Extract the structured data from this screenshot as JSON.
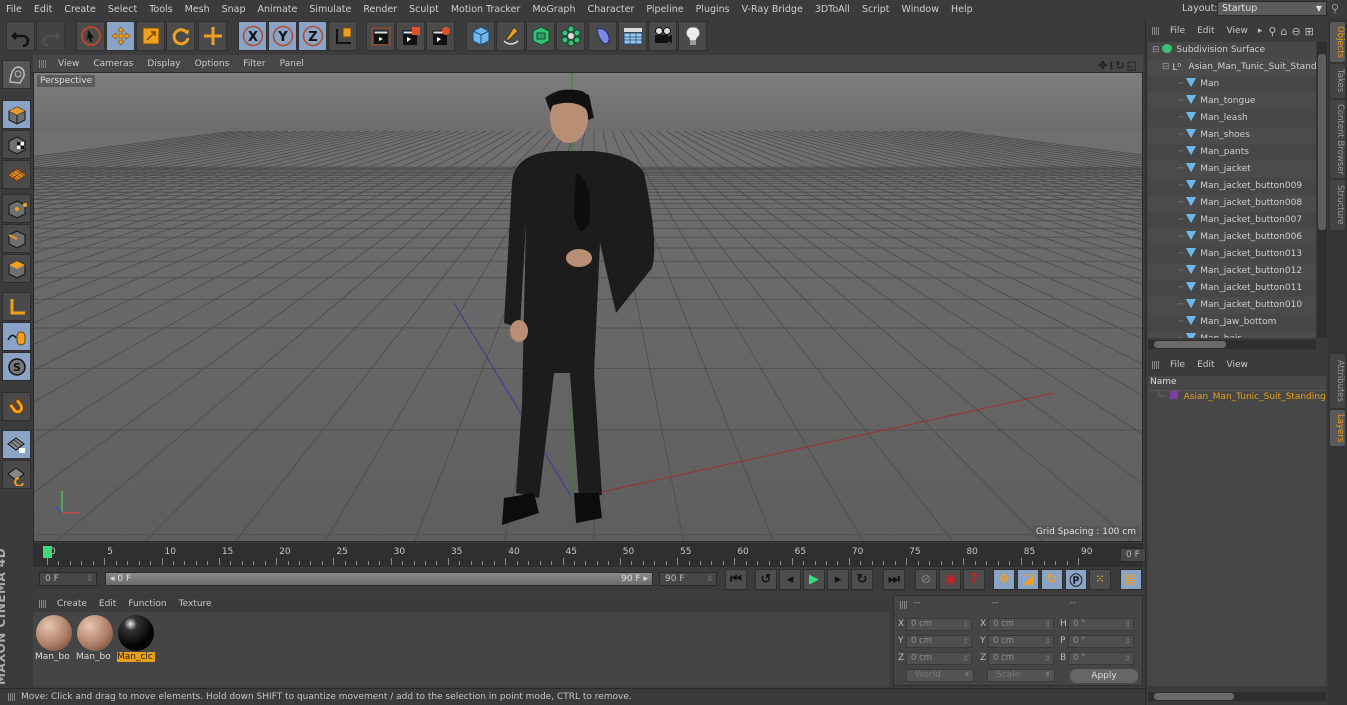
{
  "app": {
    "name": "Cinema 4D"
  },
  "menubar": {
    "items": [
      "File",
      "Edit",
      "Create",
      "Select",
      "Tools",
      "Mesh",
      "Snap",
      "Animate",
      "Simulate",
      "Render",
      "Sculpt",
      "Motion Tracker",
      "MoGraph",
      "Character",
      "Pipeline",
      "Plugins",
      "V-Ray Bridge",
      "3DToAll",
      "Script",
      "Window",
      "Help"
    ],
    "layout_label": "Layout:",
    "layout_value": "Startup"
  },
  "toolbar": {
    "tools": [
      "undo-icon",
      "redo-icon",
      "live-selection-icon",
      "move-icon",
      "scale-icon",
      "rotate-icon",
      "recent-tool-icon",
      "x-axis-lock-icon",
      "y-axis-lock-icon",
      "z-axis-lock-icon",
      "coordinate-system-icon",
      "render-view-icon",
      "render-picture-viewer-icon",
      "render-settings-icon",
      "cube-primitive-icon",
      "pen-spline-icon",
      "subdivision-surface-icon",
      "cloner-icon",
      "deformer-icon",
      "floor-icon",
      "camera-icon",
      "light-icon"
    ]
  },
  "viewport": {
    "menu": [
      "View",
      "Cameras",
      "Display",
      "Options",
      "Filter",
      "Panel"
    ],
    "label": "Perspective",
    "grid_spacing": "Grid Spacing : 100 cm",
    "nav_icons": [
      "move-view-icon",
      "dolly-view-icon",
      "rotate-view-icon",
      "maximize-view-icon"
    ]
  },
  "left_tools": [
    "make-editable-icon",
    "model-mode-icon",
    "texture-mode-icon",
    "workplane-mode-icon",
    "points-mode-icon",
    "edges-mode-icon",
    "polygons-mode-icon",
    "axis-mode-icon",
    "tweak-mode-icon",
    "solo-icon",
    "snap-icon",
    "workplane-lock-icon",
    "workplane-align-icon"
  ],
  "timeline": {
    "ticks": [
      "0",
      "5",
      "10",
      "15",
      "20",
      "25",
      "30",
      "35",
      "40",
      "45",
      "50",
      "55",
      "60",
      "65",
      "70",
      "75",
      "80",
      "85",
      "90"
    ],
    "current_frame": "0 F",
    "start_field": "0 F",
    "range_start": "0 F",
    "range_end": "90 F",
    "end_field": "90 F",
    "min_frame": 0,
    "max_frame": 90,
    "playhead_frame": 0
  },
  "transport": {
    "buttons": [
      "go-to-start-icon",
      "previous-key-icon",
      "previous-frame-icon",
      "play-icon",
      "next-frame-icon",
      "next-key-icon",
      "go-to-end-icon",
      "record-off-icon",
      "autokey-icon",
      "keyframe-selection-icon",
      "key-position-icon",
      "key-scale-icon",
      "key-rotation-icon",
      "key-parameter-icon",
      "key-pla-icon",
      "timeline-icon"
    ]
  },
  "materials": {
    "menu": [
      "Create",
      "Edit",
      "Function",
      "Texture"
    ],
    "items": [
      {
        "name": "Man_bo",
        "selected": false,
        "type": "skin"
      },
      {
        "name": "Man_bo",
        "selected": false,
        "type": "skin"
      },
      {
        "name": "Man_clc",
        "selected": true,
        "type": "black"
      }
    ]
  },
  "brand": {
    "logo": "MAXON CINEMA 4D"
  },
  "coordinates": {
    "headers": [
      "--",
      "--",
      "--"
    ],
    "rows": [
      {
        "l1": "X",
        "v1": "0 cm",
        "l2": "X",
        "v2": "0 cm",
        "l3": "H",
        "v3": "0 °"
      },
      {
        "l1": "Y",
        "v1": "0 cm",
        "l2": "Y",
        "v2": "0 cm",
        "l3": "P",
        "v3": "0 °"
      },
      {
        "l1": "Z",
        "v1": "0 cm",
        "l2": "Z",
        "v2": "0 cm",
        "l3": "B",
        "v3": "0 °"
      }
    ],
    "space_select": "World",
    "mode_select": "Scale",
    "apply_label": "Apply"
  },
  "status": {
    "text": "Move: Click and drag to move elements. Hold down SHIFT to quantize movement / add to the selection in point mode, CTRL to remove."
  },
  "objects_panel": {
    "menu": [
      "File",
      "Edit",
      "View"
    ],
    "tree": [
      {
        "name": "Subdivision Surface",
        "level": 0,
        "icon": "subdivision"
      },
      {
        "name": "Asian_Man_Tunic_Suit_Standi",
        "level": 1,
        "icon": "null"
      },
      {
        "name": "Man",
        "level": 2,
        "icon": "polygon"
      },
      {
        "name": "Man_tongue",
        "level": 2,
        "icon": "polygon"
      },
      {
        "name": "Man_leash",
        "level": 2,
        "icon": "polygon"
      },
      {
        "name": "Man_shoes",
        "level": 2,
        "icon": "polygon"
      },
      {
        "name": "Man_pants",
        "level": 2,
        "icon": "polygon"
      },
      {
        "name": "Man_jacket",
        "level": 2,
        "icon": "polygon"
      },
      {
        "name": "Man_jacket_button009",
        "level": 2,
        "icon": "polygon"
      },
      {
        "name": "Man_jacket_button008",
        "level": 2,
        "icon": "polygon"
      },
      {
        "name": "Man_jacket_button007",
        "level": 2,
        "icon": "polygon"
      },
      {
        "name": "Man_jacket_button006",
        "level": 2,
        "icon": "polygon"
      },
      {
        "name": "Man_jacket_button013",
        "level": 2,
        "icon": "polygon"
      },
      {
        "name": "Man_jacket_button012",
        "level": 2,
        "icon": "polygon"
      },
      {
        "name": "Man_jacket_button011",
        "level": 2,
        "icon": "polygon"
      },
      {
        "name": "Man_jacket_button010",
        "level": 2,
        "icon": "polygon"
      },
      {
        "name": "Man_Jaw_bottom",
        "level": 2,
        "icon": "polygon"
      },
      {
        "name": "Man_hair",
        "level": 2,
        "icon": "polygon"
      }
    ]
  },
  "layers_panel": {
    "menu": [
      "File",
      "Edit",
      "View"
    ],
    "column_header": "Name",
    "layers": [
      {
        "name": "Asian_Man_Tunic_Suit_Standing_I",
        "color": "#7a3fa0"
      }
    ]
  },
  "right_tabs": [
    {
      "label": "Objects",
      "active": true
    },
    {
      "label": "Takes",
      "active": false
    },
    {
      "label": "Content Browser",
      "active": false
    },
    {
      "label": "Structure",
      "active": false
    },
    {
      "label": "Attributes",
      "active": false
    },
    {
      "label": "Layers",
      "active": true
    }
  ],
  "colors": {
    "accent": "#e6a019",
    "selection_blue": "#8aa4c8",
    "playhead": "#3adb7a",
    "layer_color": "#7a3fa0"
  }
}
